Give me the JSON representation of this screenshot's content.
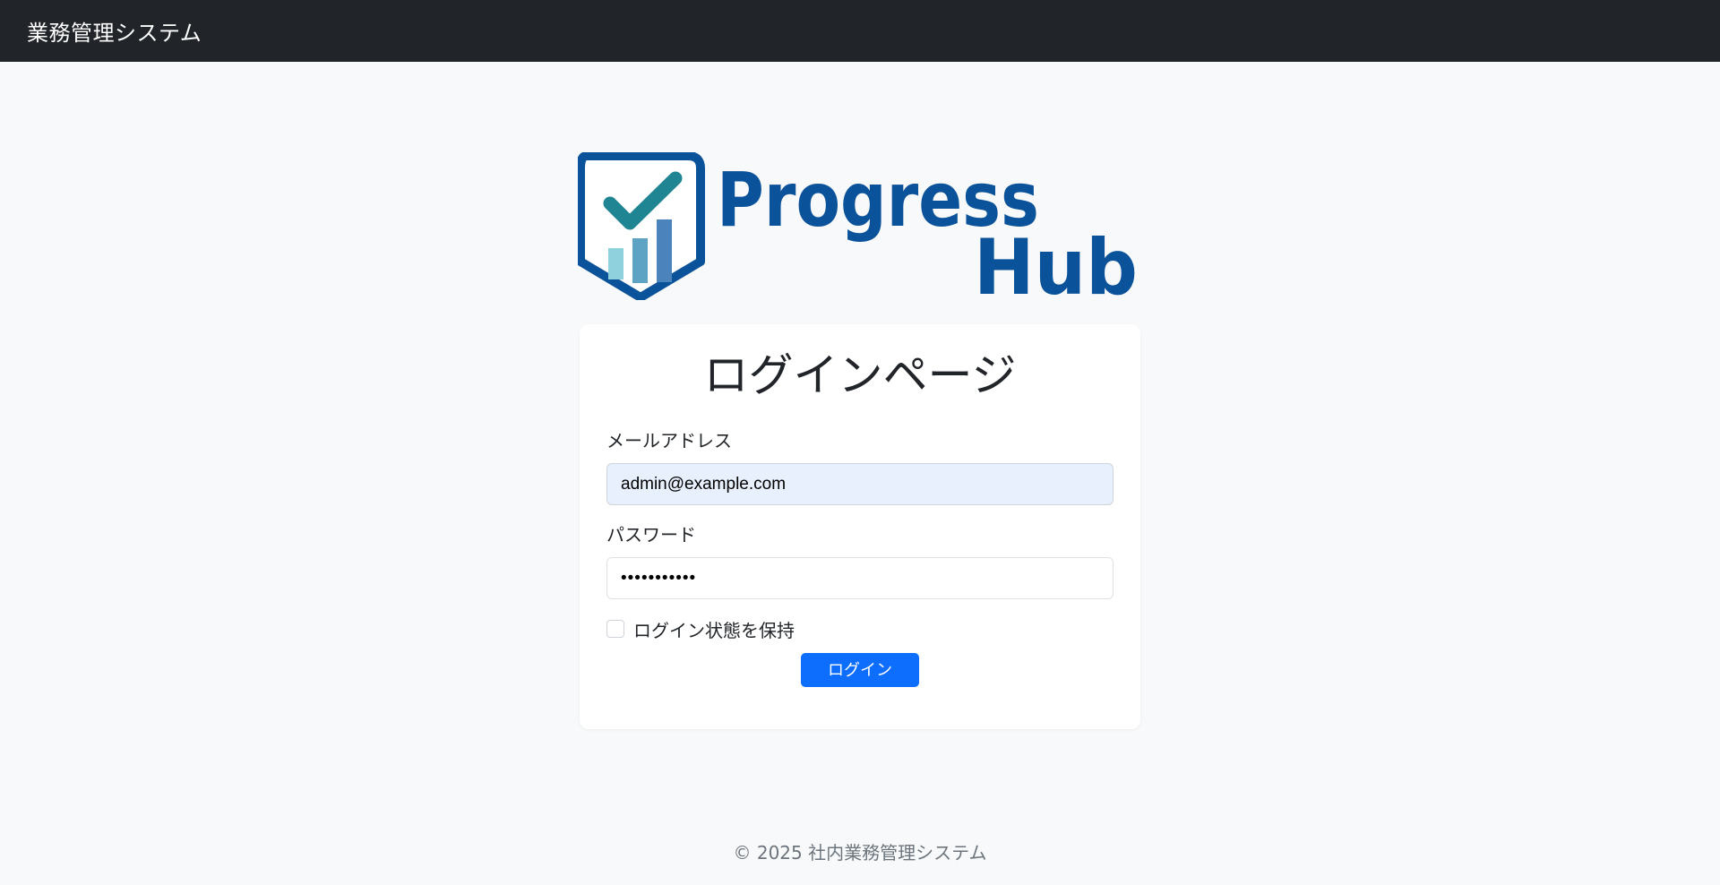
{
  "navbar": {
    "brand": "業務管理システム"
  },
  "logo": {
    "line1": "Progress",
    "line2": "Hub",
    "colors": {
      "primary": "#0a529a",
      "check": "#1f8592",
      "bar_light": "#8fd1dc",
      "bar_mid": "#5fa3c4",
      "bar_dark": "#4b84bd"
    }
  },
  "login_card": {
    "title": "ログインページ",
    "email_label": "メールアドレス",
    "email_value": "admin@example.com",
    "password_label": "パスワード",
    "password_value": "•••••••••••",
    "remember_label": "ログイン状態を保持",
    "remember_checked": false,
    "submit_label": "ログイン"
  },
  "footer": {
    "text": "© 2025 社内業務管理システム"
  },
  "theme": {
    "navbar_bg": "#212529",
    "page_bg": "#f8f9fa",
    "button_bg": "#0d6efd",
    "autofill_bg": "#e8f0fe"
  }
}
